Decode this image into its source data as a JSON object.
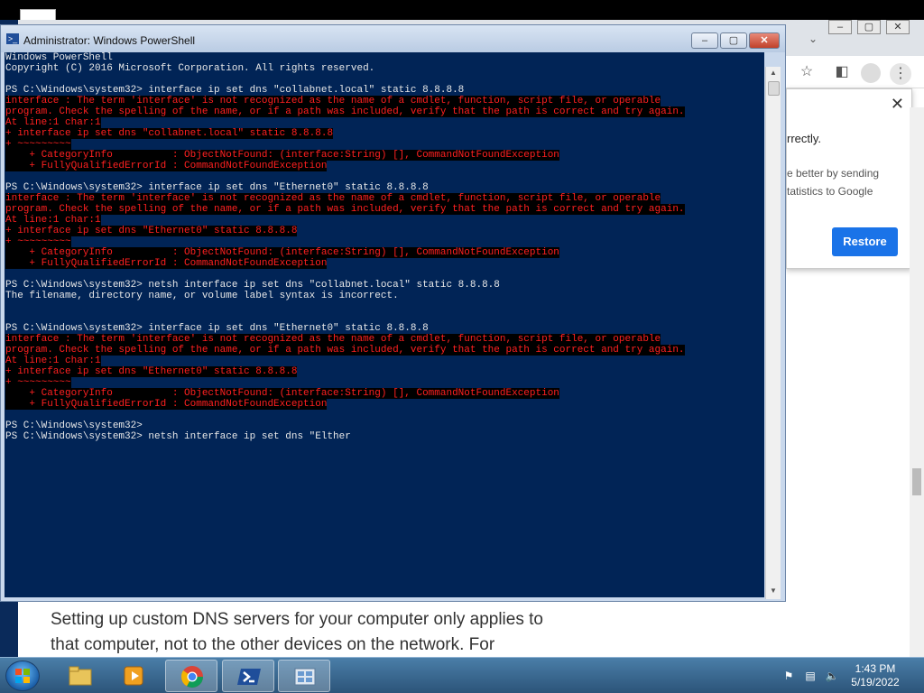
{
  "powershell": {
    "title": "Administrator: Windows PowerShell",
    "minimize": "–",
    "maximize": "▢",
    "close": "✕",
    "lines": [
      {
        "type": "out",
        "text": "Windows PowerShell"
      },
      {
        "type": "out",
        "text": "Copyright (C) 2016 Microsoft Corporation. All rights reserved."
      },
      {
        "type": "blank",
        "text": ""
      },
      {
        "type": "out",
        "text": "PS C:\\Windows\\system32> interface ip set dns \"collabnet.local\" static 8.8.8.8"
      },
      {
        "type": "err",
        "text": "interface : The term 'interface' is not recognized as the name of a cmdlet, function, script file, or operable"
      },
      {
        "type": "err",
        "text": "program. Check the spelling of the name, or if a path was included, verify that the path is correct and try again."
      },
      {
        "type": "err",
        "text": "At line:1 char:1"
      },
      {
        "type": "err",
        "text": "+ interface ip set dns \"collabnet.local\" static 8.8.8.8"
      },
      {
        "type": "err",
        "text": "+ ~~~~~~~~~"
      },
      {
        "type": "err",
        "text": "    + CategoryInfo          : ObjectNotFound: (interface:String) [], CommandNotFoundException"
      },
      {
        "type": "err",
        "text": "    + FullyQualifiedErrorId : CommandNotFoundException"
      },
      {
        "type": "blank",
        "text": ""
      },
      {
        "type": "out",
        "text": "PS C:\\Windows\\system32> interface ip set dns \"Ethernet0\" static 8.8.8.8"
      },
      {
        "type": "err",
        "text": "interface : The term 'interface' is not recognized as the name of a cmdlet, function, script file, or operable"
      },
      {
        "type": "err",
        "text": "program. Check the spelling of the name, or if a path was included, verify that the path is correct and try again."
      },
      {
        "type": "err",
        "text": "At line:1 char:1"
      },
      {
        "type": "err",
        "text": "+ interface ip set dns \"Ethernet0\" static 8.8.8.8"
      },
      {
        "type": "err",
        "text": "+ ~~~~~~~~~"
      },
      {
        "type": "err",
        "text": "    + CategoryInfo          : ObjectNotFound: (interface:String) [], CommandNotFoundException"
      },
      {
        "type": "err",
        "text": "    + FullyQualifiedErrorId : CommandNotFoundException"
      },
      {
        "type": "blank",
        "text": ""
      },
      {
        "type": "out",
        "text": "PS C:\\Windows\\system32> netsh interface ip set dns \"collabnet.local\" static 8.8.8.8"
      },
      {
        "type": "out",
        "text": "The filename, directory name, or volume label syntax is incorrect."
      },
      {
        "type": "blank",
        "text": ""
      },
      {
        "type": "blank",
        "text": ""
      },
      {
        "type": "out",
        "text": "PS C:\\Windows\\system32> interface ip set dns \"Ethernet0\" static 8.8.8.8"
      },
      {
        "type": "err",
        "text": "interface : The term 'interface' is not recognized as the name of a cmdlet, function, script file, or operable"
      },
      {
        "type": "err",
        "text": "program. Check the spelling of the name, or if a path was included, verify that the path is correct and try again."
      },
      {
        "type": "err",
        "text": "At line:1 char:1"
      },
      {
        "type": "err",
        "text": "+ interface ip set dns \"Ethernet0\" static 8.8.8.8"
      },
      {
        "type": "err",
        "text": "+ ~~~~~~~~~"
      },
      {
        "type": "err",
        "text": "    + CategoryInfo          : ObjectNotFound: (interface:String) [], CommandNotFoundException"
      },
      {
        "type": "err",
        "text": "    + FullyQualifiedErrorId : CommandNotFoundException"
      },
      {
        "type": "blank",
        "text": ""
      },
      {
        "type": "out",
        "text": "PS C:\\Windows\\system32>"
      },
      {
        "type": "out",
        "text": "PS C:\\Windows\\system32> netsh interface ip set dns \"Elther"
      }
    ]
  },
  "chrome": {
    "popup": {
      "close": "✕",
      "title_fragment": "rrectly.",
      "line1": "e better by sending",
      "line2": "tatistics to Google",
      "restore_label": "Restore"
    },
    "article_line1": "Setting up custom DNS servers for your computer only applies to",
    "article_line2": "that computer, not to the other devices on the network. For"
  },
  "taskbar": {
    "apps": [
      {
        "name": "explorer",
        "icon": "folder-icon"
      },
      {
        "name": "media-player",
        "icon": "media-player-icon"
      },
      {
        "name": "chrome",
        "icon": "chrome-icon"
      },
      {
        "name": "powershell",
        "icon": "powershell-icon"
      },
      {
        "name": "server-manager",
        "icon": "server-manager-icon"
      }
    ],
    "time": "1:43 PM",
    "date": "5/19/2022"
  },
  "colors": {
    "console_bg": "#012456",
    "error_fg": "#ff2020",
    "restore_blue": "#1a73e8"
  }
}
